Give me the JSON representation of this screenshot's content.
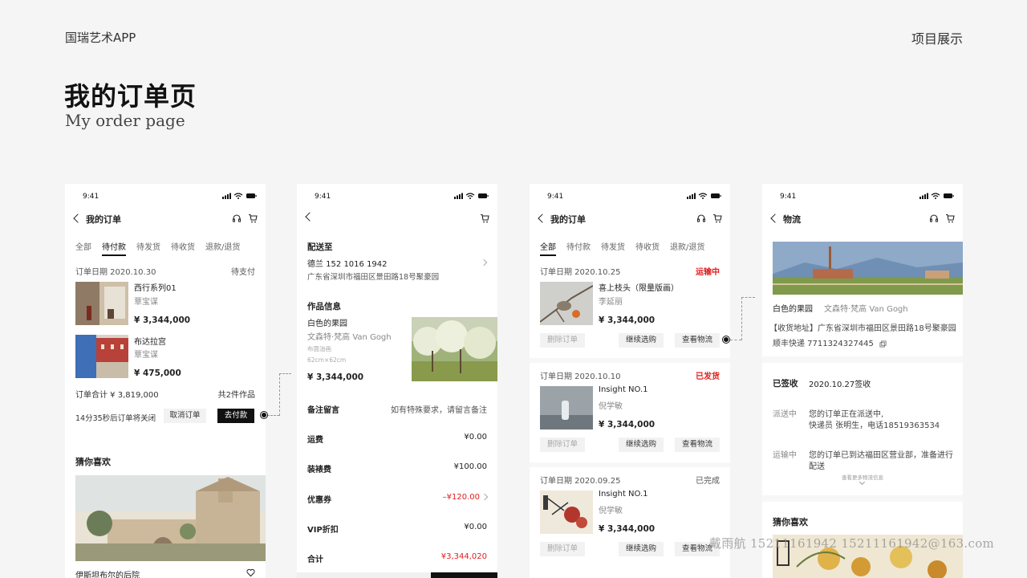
{
  "brand": "国瑞艺术APP",
  "top_right": "项目展示",
  "title_zh": "我的订单页",
  "title_en": "My order page",
  "time": "9:41",
  "screen1": {
    "nav_title": "我的订单",
    "tabs": [
      "全部",
      "待付款",
      "待发货",
      "待收货",
      "退款/退货"
    ],
    "order_date": "订单日期  2020.10.30",
    "order_status": "待支付",
    "items": [
      {
        "name": "西行系列01",
        "artist": "覃宝谋",
        "price": "¥ 3,344,000"
      },
      {
        "name": "布达拉宫",
        "artist": "覃宝谋",
        "price": "¥ 475,000"
      }
    ],
    "total": "订单合计  ¥ 3,819,000",
    "count": "共2件作品",
    "countdown": "14分35秒后订单将关闭",
    "cancel_btn": "取消订单",
    "pay_btn": "去付款",
    "guess_title": "猜你喜欢",
    "rec_name": "伊斯坦布尔的后院"
  },
  "screen2": {
    "ship_title": "配送至",
    "receiver": "德兰   152 1016 1942",
    "address": "广东省深圳市福田区景田路18号聚豪园",
    "info_title": "作品信息",
    "art_name": "白色的果园",
    "art_artist": "文森特·梵高   Van Gogh",
    "art_medium": "布面油画",
    "art_size": "62cm×62cm",
    "art_price": "¥ 3,344,000",
    "rows": [
      {
        "label": "备注留言",
        "value": "如有特殊要求，请留言备注"
      },
      {
        "label": "运费",
        "value": "¥0.00"
      },
      {
        "label": "装裱费",
        "value": "¥100.00"
      },
      {
        "label": "优惠券",
        "value": "–¥120.00"
      },
      {
        "label": "VIP折扣",
        "value": "¥0.00"
      },
      {
        "label": "合计",
        "value": "¥3,344,020"
      }
    ]
  },
  "screen3": {
    "nav_title": "我的订单",
    "tabs": [
      "全部",
      "待付款",
      "待发货",
      "待收货",
      "退款/退货"
    ],
    "orders": [
      {
        "date": "订单日期  2020.10.25",
        "status": "运输中",
        "name": "喜上枝头（限量版画）",
        "artist": "李延丽",
        "price": "¥ 3,344,000"
      },
      {
        "date": "订单日期  2020.10.10",
        "status": "已发货",
        "name": "Insight NO.1",
        "artist": "倪学敏",
        "price": "¥ 3,344,000"
      },
      {
        "date": "订单日期  2020.09.25",
        "status": "已完成",
        "name": "Insight NO.1",
        "artist": "倪学敏",
        "price": "¥ 3,344,000"
      }
    ],
    "btn_delete": "删除订单",
    "btn_continue": "继续选购",
    "btn_logistics": "查看物流"
  },
  "screen4": {
    "nav_title": "物流",
    "art_name": "白色的果园",
    "art_artist": "文森特·梵高   Van Gogh",
    "address": "【收货地址】广东省深圳市福田区景田路18号聚豪园",
    "tracking": "顺丰快递   7711324327445",
    "signed_label": "已签收",
    "signed_value": "2020.10.27签收",
    "events": [
      {
        "label": "派送中",
        "line1": "您的订单正在派送中,",
        "line2": "快递员 张明生，电话18519363534"
      },
      {
        "label": "运输中",
        "line1": "您的订单已到达福田区营业部，准备进行",
        "line2": "配送"
      }
    ],
    "more": "查看更多物流信息",
    "guess_title": "猜你喜欢"
  },
  "watermark": "戴雨航    15211161942    15211161942@163.com"
}
